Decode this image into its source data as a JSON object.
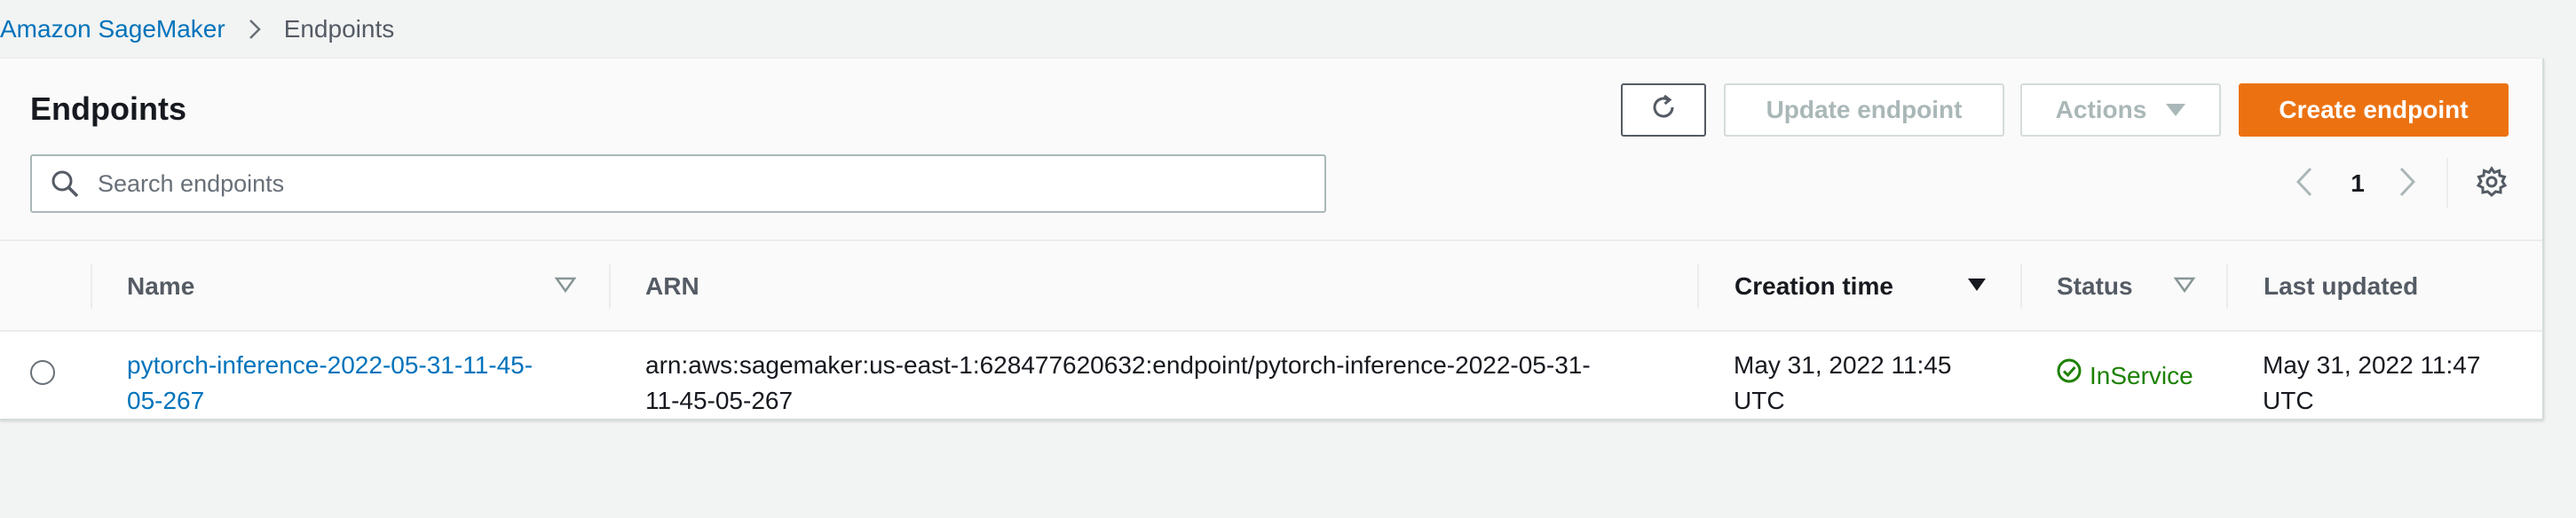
{
  "breadcrumb": {
    "root": "Amazon SageMaker",
    "current": "Endpoints"
  },
  "header": {
    "title": "Endpoints",
    "update_label": "Update endpoint",
    "actions_label": "Actions",
    "create_label": "Create endpoint"
  },
  "search": {
    "placeholder": "Search endpoints",
    "value": ""
  },
  "pagination": {
    "current_page": "1"
  },
  "table": {
    "columns": [
      "Name",
      "ARN",
      "Creation time",
      "Status",
      "Last updated"
    ],
    "sorted_column": "Creation time",
    "rows": [
      {
        "name_line1": "pytorch-inference-2022-05-31-11-45-",
        "name_line2": "05-267",
        "arn_line1": "arn:aws:sagemaker:us-east-1:628477620632:endpoint/pytorch-inference-2022-05-31-",
        "arn_line2": "11-45-05-267",
        "created_line1": "May 31, 2022 11:45",
        "created_line2": "UTC",
        "status": "InService",
        "updated_line1": "May 31, 2022 11:47",
        "updated_line2": "UTC",
        "selected": false
      }
    ]
  },
  "colors": {
    "link": "#0073bb",
    "primary": "#ec7211",
    "success": "#1d8102",
    "background": "#f2f3f3"
  },
  "icons": [
    "chevron-right-icon",
    "refresh-icon",
    "caret-down-icon",
    "search-icon",
    "chevron-left-icon",
    "gear-icon",
    "sort-icon",
    "check-circle-icon"
  ]
}
